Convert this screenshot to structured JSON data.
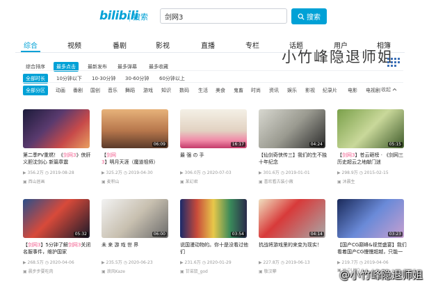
{
  "header": {
    "logo": "bilibili",
    "logo_sub": "搜索",
    "search_value": "剑网3",
    "search_button": "搜索"
  },
  "tabs": [
    {
      "label": "综合",
      "active": true
    },
    {
      "label": "视频"
    },
    {
      "label": "番剧"
    },
    {
      "label": "影视"
    },
    {
      "label": "直播"
    },
    {
      "label": "专栏"
    },
    {
      "label": "话题"
    },
    {
      "label": "用户"
    },
    {
      "label": "相簿"
    }
  ],
  "watermark_top": "小竹峰隐退师姐",
  "sort_options": [
    {
      "label": "综合排序"
    },
    {
      "label": "最多点击",
      "active": true
    },
    {
      "label": "最新发布"
    },
    {
      "label": "最多弹幕"
    },
    {
      "label": "最多收藏"
    }
  ],
  "duration_options": [
    {
      "label": "全部时长",
      "active": true
    },
    {
      "label": "10分钟以下"
    },
    {
      "label": "10-30分钟"
    },
    {
      "label": "30-60分钟"
    },
    {
      "label": "60分钟以上"
    }
  ],
  "zone_options": [
    {
      "label": "全部分区",
      "active": true
    },
    {
      "label": "动画"
    },
    {
      "label": "番剧"
    },
    {
      "label": "国创"
    },
    {
      "label": "音乐"
    },
    {
      "label": "舞蹈"
    },
    {
      "label": "游戏"
    },
    {
      "label": "知识"
    },
    {
      "label": "数码"
    },
    {
      "label": "生活"
    },
    {
      "label": "美食"
    },
    {
      "label": "鬼畜"
    },
    {
      "label": "时尚"
    },
    {
      "label": "资讯"
    },
    {
      "label": "娱乐"
    },
    {
      "label": "影视"
    },
    {
      "label": "纪录片"
    },
    {
      "label": "电影"
    },
    {
      "label": "电视剧"
    }
  ],
  "collapse_label": "收起",
  "videos": [
    {
      "duration": "",
      "title_pre": "第二季PV重燃！《",
      "title_hl": "剑网3",
      "title_post": "》侠肝义胆沈剑心 新篇章震",
      "views": "356.2万",
      "date": "2019-08-28",
      "uploader": "西山居画"
    },
    {
      "duration": "06:09",
      "title_pre": "【",
      "title_hl": "剑网3",
      "title_post": "】明月天涯（魔道祖师）",
      "views": "325.2万",
      "date": "2019-04-30",
      "uploader": "麦积山"
    },
    {
      "duration": "16:17",
      "title_pre": "",
      "title_hl": "",
      "title_post": "最 强 の 手",
      "views": "306.0万",
      "date": "2020-07-03",
      "uploader": "某幻君"
    },
    {
      "duration": "04:24",
      "title_pre": "【仙剑奇侠传三】我们的生不独十年纪念",
      "title_hl": "",
      "title_post": "",
      "views": "301.6万",
      "date": "2019-01-01",
      "uploader": "喜欢看古装小薇"
    },
    {
      "duration": "05:15",
      "title_pre": "【",
      "title_hl": "剑网3",
      "title_post": "】苍云砸榜 · 《剑网三历史超云之地献门迷",
      "views": "298.9万",
      "date": "2015-02-15",
      "uploader": "沐晨生"
    },
    {
      "duration": "05:32",
      "title_pre": "【",
      "title_hl": "剑网3",
      "title_post": "】5分钟了解",
      "title_hl2": "剑网3",
      "title_post2": "关闭名服事件，维护国家",
      "views": "268.5万",
      "date": "2020-04-06",
      "uploader": "晨步步要吃肉"
    },
    {
      "duration": "06:00",
      "title_pre": "",
      "title_hl": "",
      "title_post": "未 来 游 戏 世 界",
      "views": "235.5万",
      "date": "2020-06-23",
      "uploader": "浪风Kaze"
    },
    {
      "duration": "03:54",
      "title_pre": "说国漫动物的。你十是没看过他们",
      "title_hl": "",
      "title_post": "",
      "views": "231.6万",
      "date": "2020-01-29",
      "uploader": "甘诺鼠_god"
    },
    {
      "duration": "04:14",
      "title_pre": "抗战将游戏里的来变为现实！",
      "title_hl": "",
      "title_post": "",
      "views": "227.8万",
      "date": "2019-06-13",
      "uploader": "敬汉攀"
    },
    {
      "duration": "03:23",
      "title_pre": "【国产CG巅峰&视觉盛宴】我们看着国产CG慢慢超越，只能一",
      "title_hl": "",
      "title_post": "",
      "views": "219.7万",
      "date": "2019-04-06",
      "uploader": "YJ.DLMQ"
    }
  ],
  "watermark_bottom": "@小竹峰隐退师姐",
  "colors": {
    "accent": "#00a1d6",
    "highlight": "#f25d8e"
  }
}
